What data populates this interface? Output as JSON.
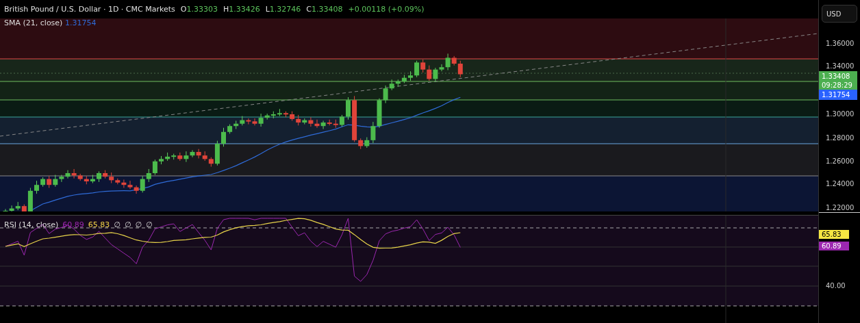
{
  "legend": {
    "title": "British Pound / U.S. Dollar · 1D · CMC Markets",
    "ohlc": [
      {
        "label": "O",
        "value": "1.33303"
      },
      {
        "label": "H",
        "value": "1.33426"
      },
      {
        "label": "L",
        "value": "1.32746"
      },
      {
        "label": "C",
        "value": "1.33408"
      }
    ],
    "change": "+0.00118 (+0.09%)"
  },
  "sma": {
    "label": "SMA (21, close)",
    "value": "1.31754"
  },
  "rsi": {
    "label": "RSI (14, close)",
    "values": [
      {
        "text": "60.89",
        "color": "#9c27b0"
      },
      {
        "text": "65.83",
        "color": "#f5d547"
      }
    ],
    "extras": [
      "∅",
      "∅",
      "∅",
      "∅"
    ]
  },
  "price_axis": {
    "currency": "USD",
    "ticks": [
      "1.36000",
      "1.34000",
      "1.30000",
      "1.28000",
      "1.26000",
      "1.24000",
      "1.22000"
    ],
    "tags": [
      {
        "value": "1.33408",
        "time": "09:28:29",
        "color": "#4caf50"
      },
      {
        "value": "1.31754",
        "color": "#2962ff"
      }
    ]
  },
  "rsi_axis": {
    "ticks": [
      "40.00"
    ],
    "tags": [
      {
        "value": "65.83",
        "color": "#f5e642"
      },
      {
        "value": "60.89",
        "color": "#9c27b0"
      }
    ]
  }
}
